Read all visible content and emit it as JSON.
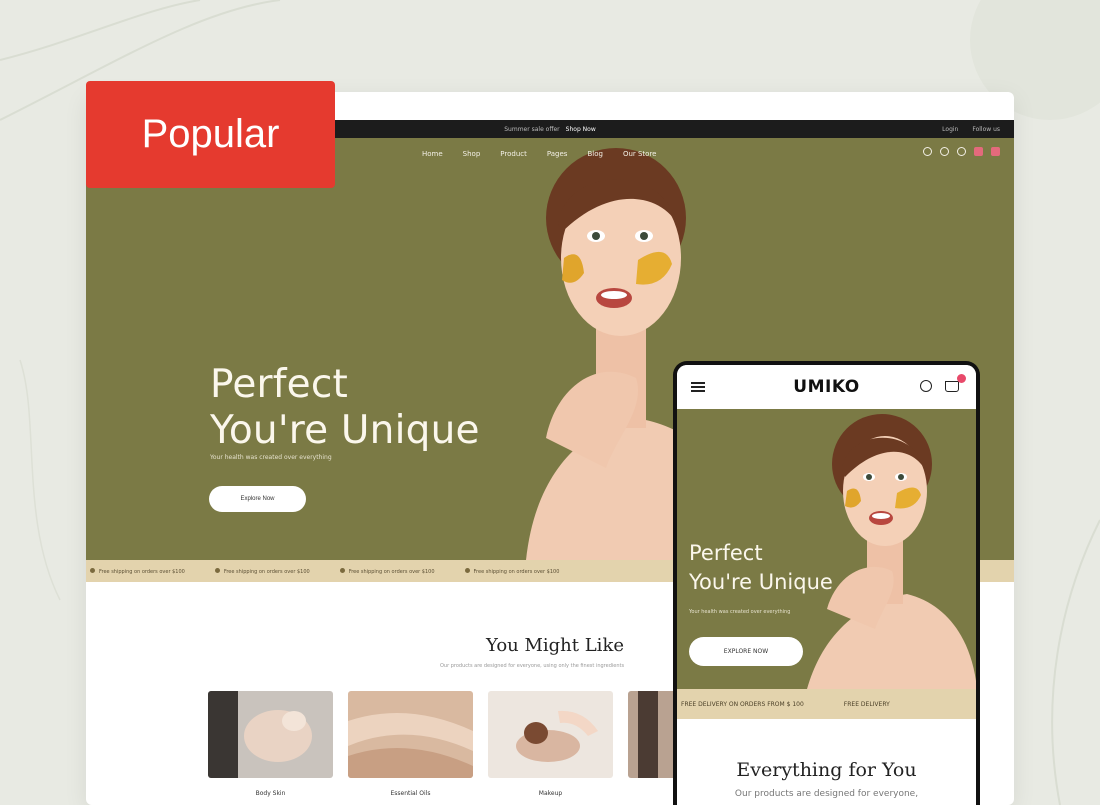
{
  "badge": {
    "label": "Popular"
  },
  "desktop": {
    "topbar": {
      "announcement": "Summer sale offer",
      "link": "Shop Now",
      "right_items": [
        "Login",
        "Follow us"
      ]
    },
    "nav": {
      "items": [
        "Home",
        "Shop",
        "Product",
        "Pages",
        "Blog",
        "Our Store"
      ]
    },
    "hero": {
      "title_line1": "Perfect",
      "title_line2": "You're Unique",
      "subtitle": "Your health was created over everything",
      "button_label": "Explore Now"
    },
    "ticker": [
      "Free shipping on orders over $100",
      "Free shipping on orders over $100",
      "Free shipping on orders over $100",
      "Free shipping on orders over $100"
    ],
    "section": {
      "title": "You Might Like",
      "subtitle": "Our products are designed for everyone, using only the finest ingredients"
    },
    "cards": [
      {
        "label": "Body Skin"
      },
      {
        "label": "Essential Oils"
      },
      {
        "label": "Makeup"
      }
    ]
  },
  "phone": {
    "logo": "UMIKO",
    "hero": {
      "title_line1": "Perfect",
      "title_line2": "You're Unique",
      "subtitle": "Your health was created over everything",
      "button_label": "EXPLORE NOW"
    },
    "ticker": [
      "FREE DELIVERY ON ORDERS FROM $ 100",
      "FREE DELIVERY"
    ],
    "section": {
      "title": "Everything for You",
      "subtitle": "Our products are designed for everyone,"
    }
  },
  "colors": {
    "hero_green": "#7b7a45",
    "badge_red": "#e53a2f",
    "ticker_beige": "#e3d3ad"
  }
}
